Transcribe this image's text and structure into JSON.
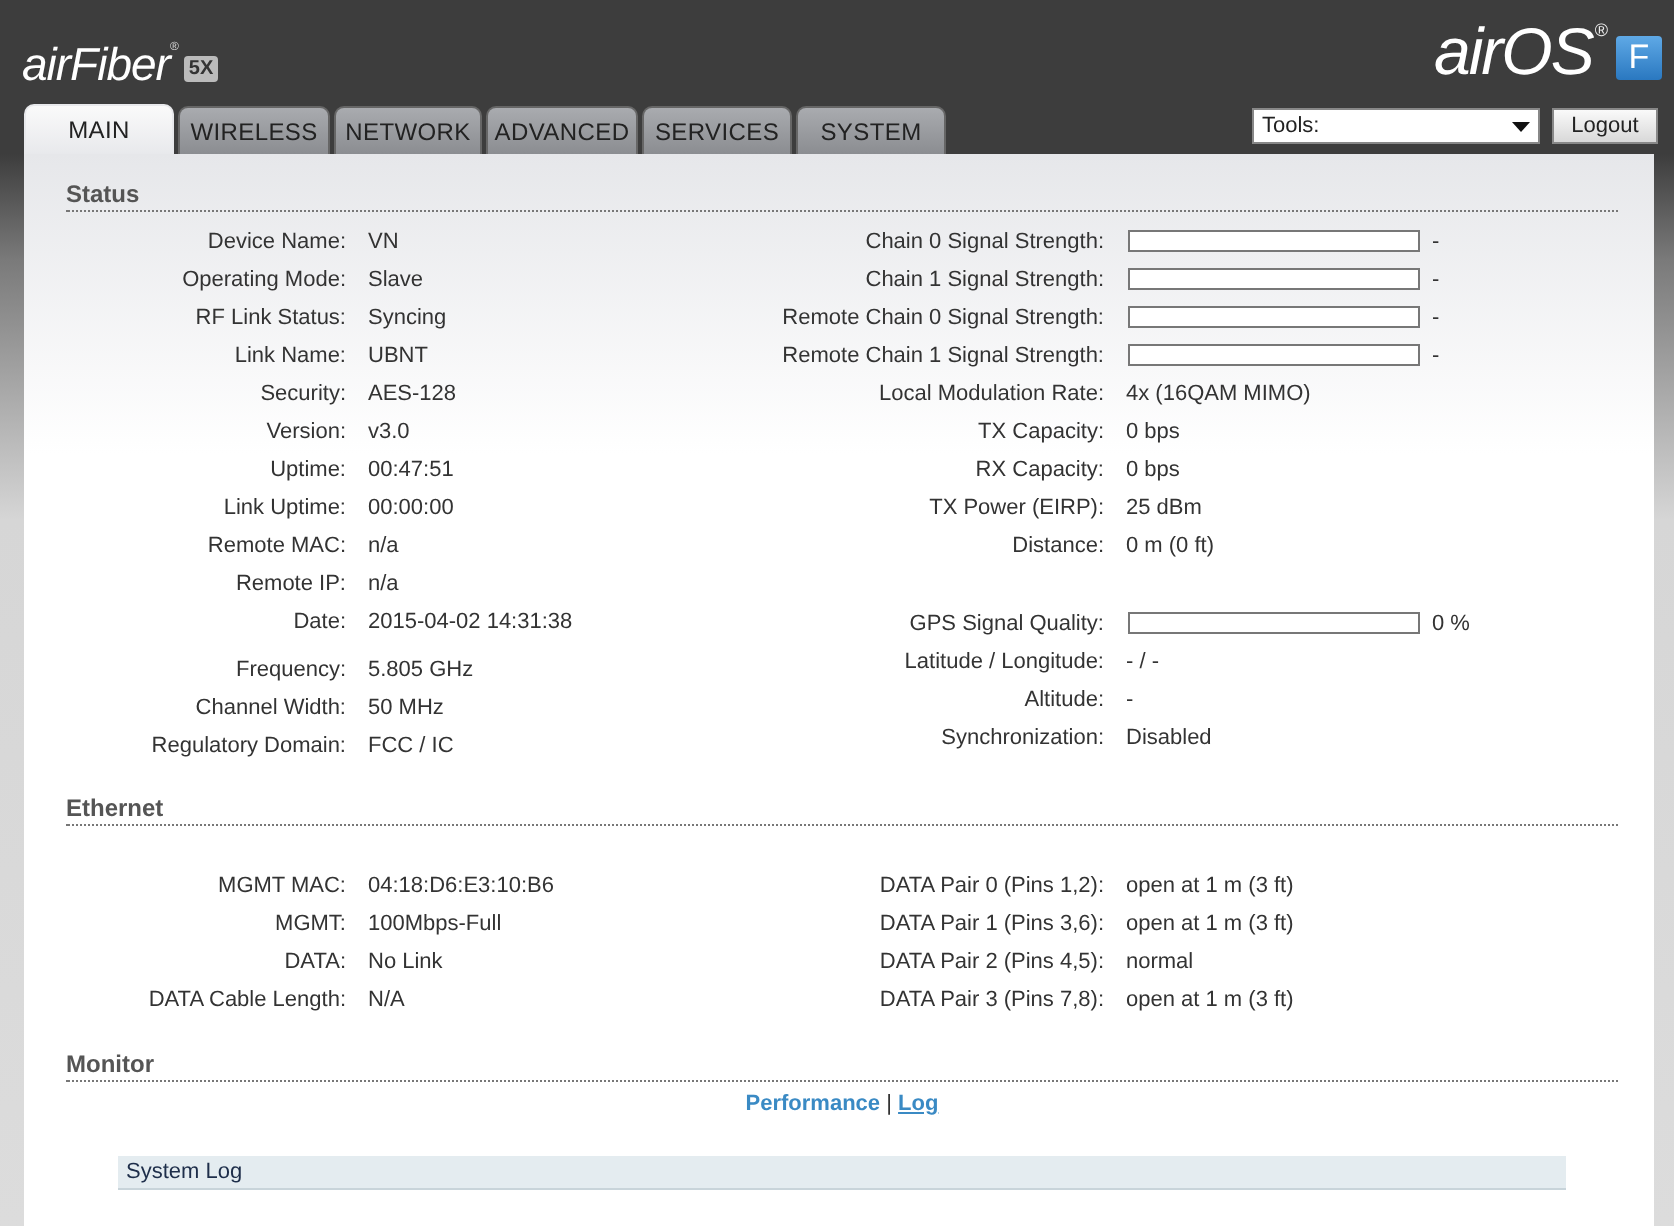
{
  "header": {
    "product": "airFiber",
    "product_mark": "®",
    "model_badge": "5X",
    "os_logo": "airOS",
    "os_mark": "®",
    "os_badge": "F"
  },
  "tabs": [
    {
      "label": "MAIN",
      "selected": true
    },
    {
      "label": "WIRELESS",
      "selected": false
    },
    {
      "label": "NETWORK",
      "selected": false
    },
    {
      "label": "ADVANCED",
      "selected": false
    },
    {
      "label": "SERVICES",
      "selected": false
    },
    {
      "label": "SYSTEM",
      "selected": false
    }
  ],
  "tools": {
    "value": "Tools:",
    "logout": "Logout"
  },
  "status": {
    "title": "Status",
    "left": [
      [
        {
          "kind": "text",
          "label": "Device Name:",
          "value": "VN"
        },
        {
          "kind": "text",
          "label": "Operating Mode:",
          "value": "Slave"
        },
        {
          "kind": "text",
          "label": "RF Link Status:",
          "value": "Syncing"
        },
        {
          "kind": "text",
          "label": "Link Name:",
          "value": "UBNT"
        },
        {
          "kind": "text",
          "label": "Security:",
          "value": "AES-128"
        },
        {
          "kind": "text",
          "label": "Version:",
          "value": "v3.0"
        },
        {
          "kind": "text",
          "label": "Uptime:",
          "value": "00:47:51"
        },
        {
          "kind": "text",
          "label": "Link Uptime:",
          "value": "00:00:00"
        },
        {
          "kind": "text",
          "label": "Remote MAC:",
          "value": "n/a"
        },
        {
          "kind": "text",
          "label": "Remote IP:",
          "value": "n/a"
        },
        {
          "kind": "text",
          "label": "Date:",
          "value": "2015-04-02 14:31:38"
        }
      ],
      [
        {
          "kind": "text",
          "label": "Frequency:",
          "value": "5.805 GHz"
        },
        {
          "kind": "text",
          "label": "Channel Width:",
          "value": "50 MHz"
        },
        {
          "kind": "text",
          "label": "Regulatory Domain:",
          "value": "FCC / IC"
        }
      ]
    ],
    "right": [
      [
        {
          "kind": "bar",
          "label": "Chain 0 Signal Strength:",
          "level": 0,
          "reading": "-"
        },
        {
          "kind": "bar",
          "label": "Chain 1 Signal Strength:",
          "level": 0,
          "reading": "-"
        },
        {
          "kind": "bar",
          "label": "Remote Chain 0 Signal Strength:",
          "level": 0,
          "reading": "-"
        },
        {
          "kind": "bar",
          "label": "Remote Chain 1 Signal Strength:",
          "level": 0,
          "reading": "-"
        },
        {
          "kind": "text",
          "label": "Local Modulation Rate:",
          "value": "4x (16QAM MIMO)"
        },
        {
          "kind": "text",
          "label": "TX Capacity:",
          "value": "0 bps"
        },
        {
          "kind": "text",
          "label": "RX Capacity:",
          "value": "0 bps"
        },
        {
          "kind": "text",
          "label": "TX Power (EIRP):",
          "value": "25 dBm"
        },
        {
          "kind": "text",
          "label": "Distance:",
          "value": "0 m (0 ft)"
        }
      ],
      [
        {
          "kind": "bar",
          "label": "GPS Signal Quality:",
          "level": 0,
          "reading": "0 %"
        },
        {
          "kind": "text",
          "label": "Latitude / Longitude:",
          "value": "- / -"
        },
        {
          "kind": "text",
          "label": "Altitude:",
          "value": "-"
        },
        {
          "kind": "text",
          "label": "Synchronization:",
          "value": "Disabled"
        }
      ]
    ]
  },
  "ethernet": {
    "title": "Ethernet",
    "left": [
      [
        {
          "kind": "text",
          "label": "MGMT MAC:",
          "value": "04:18:D6:E3:10:B6"
        },
        {
          "kind": "text",
          "label": "MGMT:",
          "value": "100Mbps-Full"
        },
        {
          "kind": "text",
          "label": "DATA:",
          "value": "No Link"
        },
        {
          "kind": "text",
          "label": "DATA Cable Length:",
          "value": "N/A"
        }
      ]
    ],
    "right": [
      [
        {
          "kind": "text",
          "label": "DATA Pair 0 (Pins 1,2):",
          "value": "open at 1 m (3 ft)"
        },
        {
          "kind": "text",
          "label": "DATA Pair 1 (Pins 3,6):",
          "value": "open at 1 m (3 ft)"
        },
        {
          "kind": "text",
          "label": "DATA Pair 2 (Pins 4,5):",
          "value": "normal"
        },
        {
          "kind": "text",
          "label": "DATA Pair 3 (Pins 7,8):",
          "value": "open at 1 m (3 ft)"
        }
      ]
    ]
  },
  "monitor": {
    "title": "Monitor",
    "links": [
      {
        "label": "Performance",
        "selected": true
      },
      {
        "label": "Log",
        "selected": false
      }
    ],
    "separator": "|",
    "log_title": "System Log"
  }
}
